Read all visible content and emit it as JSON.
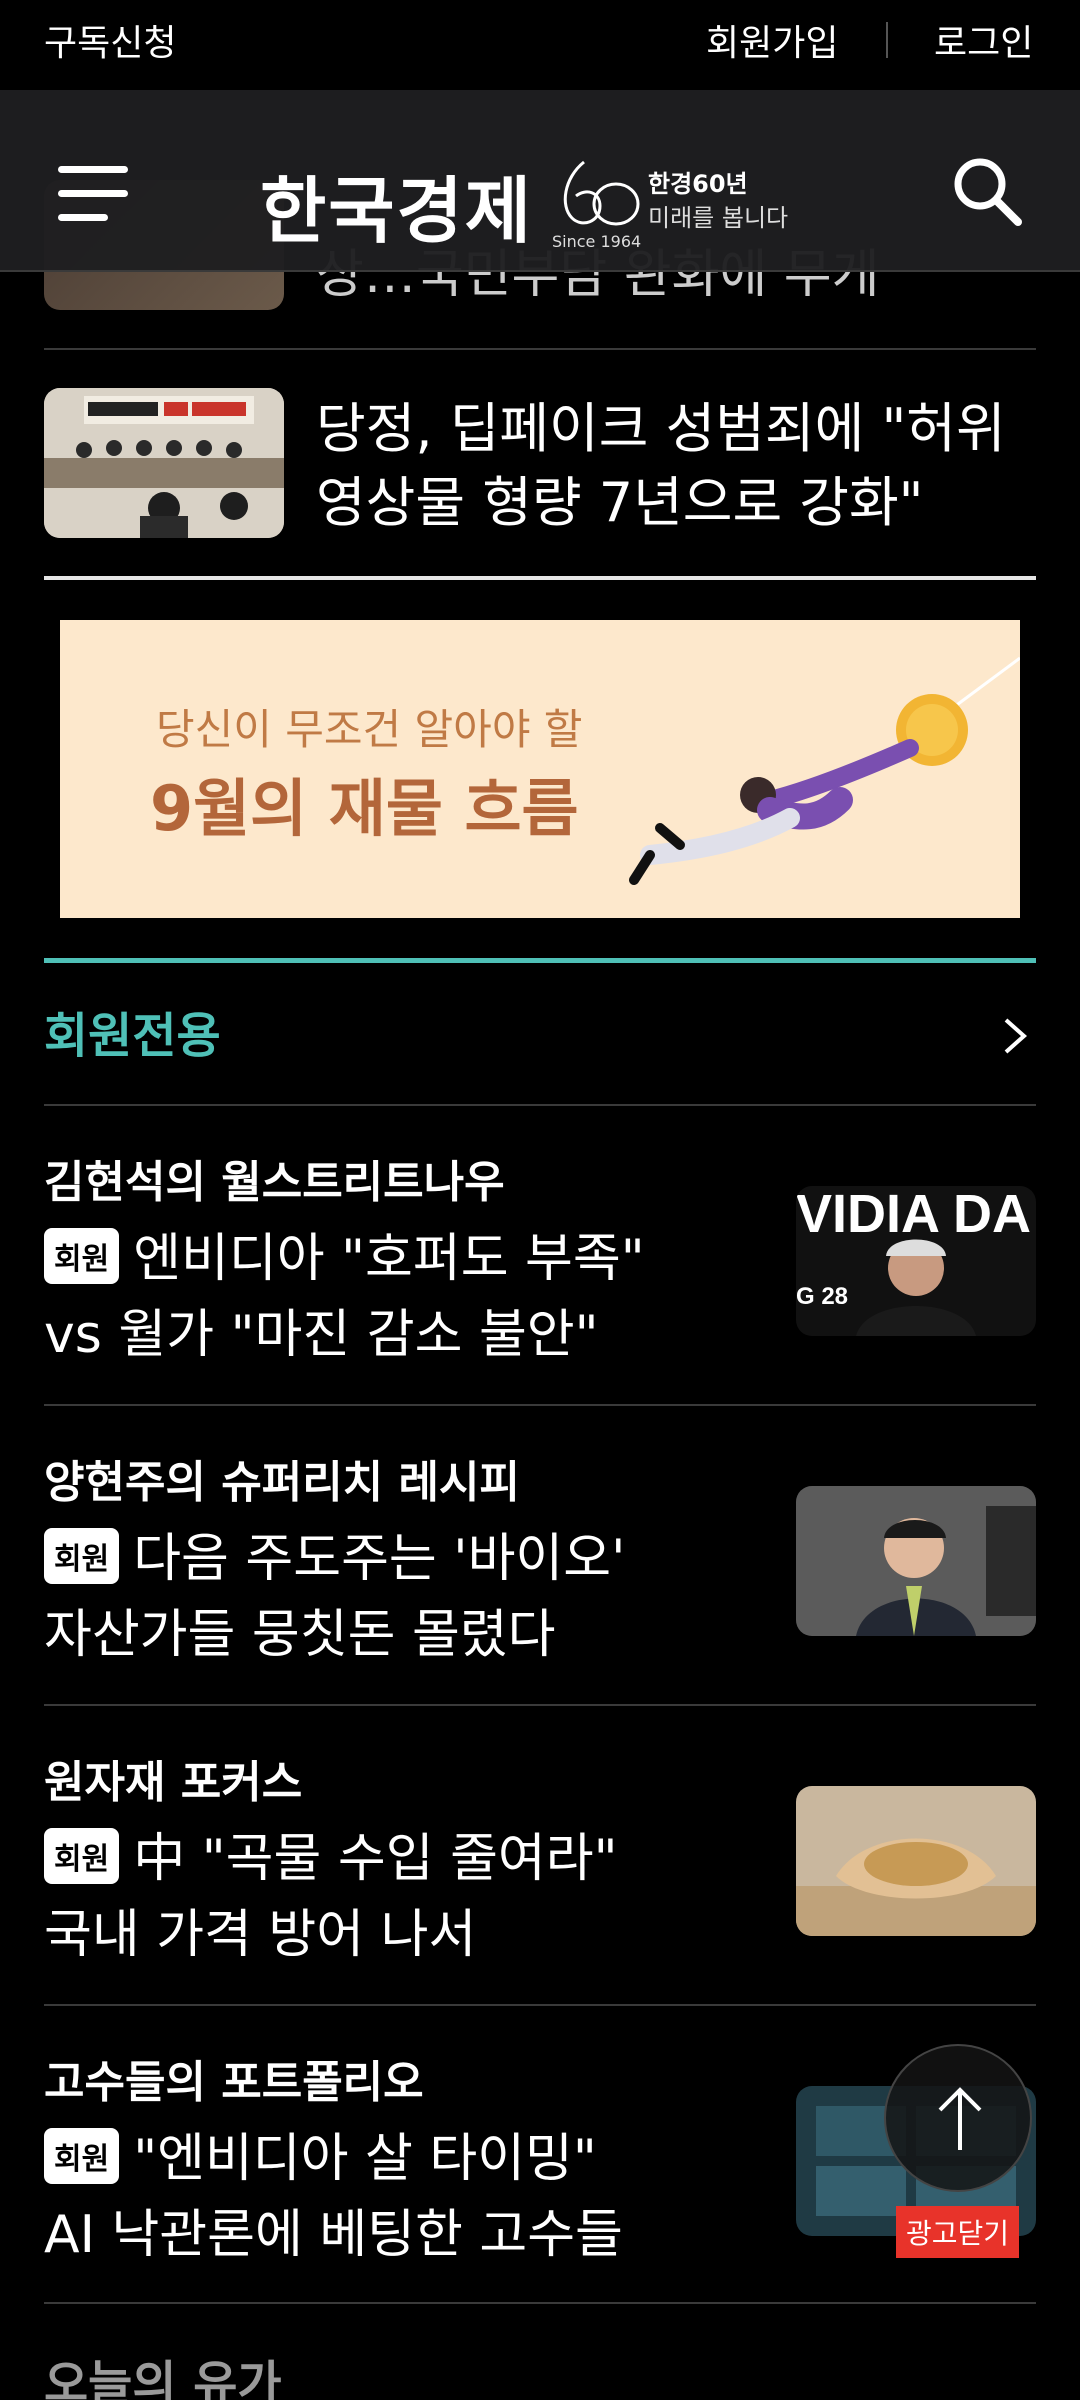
{
  "topbar": {
    "subscribe": "구독신청",
    "signup": "회원가입",
    "login": "로그인"
  },
  "header": {
    "logo_name": "한국경제",
    "logo_since": "Since 1964",
    "logo_tagline_1": "한경60년",
    "logo_tagline_2": "미래를 봅니다",
    "menu_icon": "hamburger-icon",
    "search_icon": "search-icon"
  },
  "feed": {
    "peek_title": "상…국민부담 완화에 무게",
    "news_item": {
      "title_line1": "당정, 딥페이크 성범죄에 \"허위",
      "title_line2": "영상물 형량 7년으로 강화\""
    }
  },
  "ad_banner": {
    "line1": "당신이 무조건 알아야 할",
    "line2": "9월의 재물 흐름"
  },
  "members": {
    "section_title": "회원전용",
    "badge": "회원",
    "items": [
      {
        "category": "김현석의 월스트리트나우",
        "line1": "엔비디아 \"호퍼도 부족\"",
        "line2": "vs 월가 \"마진 감소 불안\""
      },
      {
        "category": "양현주의 슈퍼리치 레시피",
        "line1": "다음 주도주는 '바이오'",
        "line2": "자산가들 뭉칫돈 몰렸다"
      },
      {
        "category": "원자재 포커스",
        "line1": "中 \"곡물 수입 줄여라\"",
        "line2": "국내 가격 방어 나서"
      },
      {
        "category": "고수들의 포트폴리오",
        "line1": "\"엔비디아 살 타이밍\"",
        "line2": "AI 낙관론에 베팅한 고수들"
      }
    ]
  },
  "ad_close": "광고닫기",
  "next_section": "오늘의 유가",
  "colors": {
    "accent": "#4fc0b7",
    "background": "#000000",
    "ad_close": "#e8332a"
  }
}
